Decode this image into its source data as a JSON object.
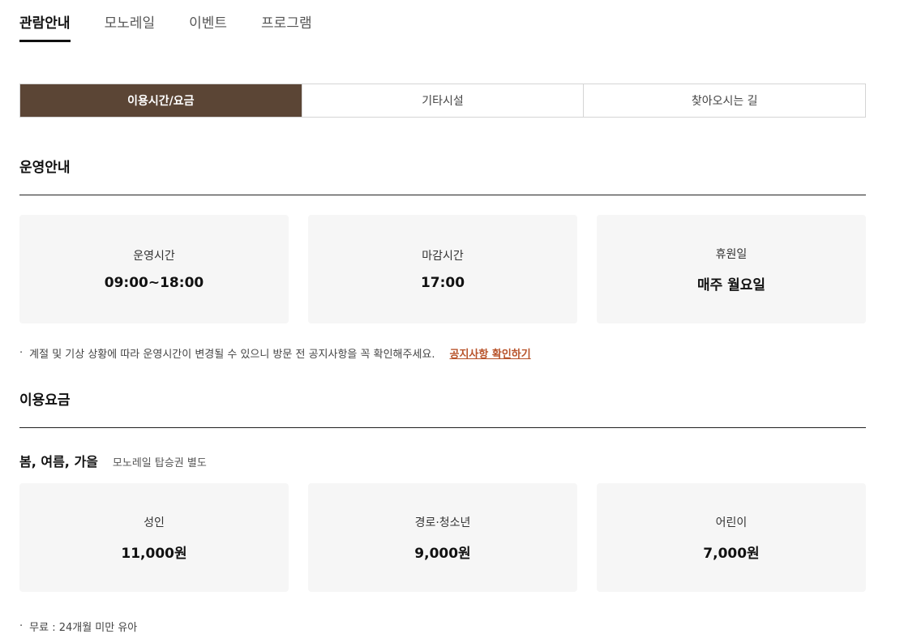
{
  "top_tabs": [
    "관람안내",
    "모노레일",
    "이벤트",
    "프로그램"
  ],
  "sub_tabs": [
    "이용시간/요금",
    "기타시설",
    "찾아오시는 길"
  ],
  "operation": {
    "title": "운영안내",
    "cards": [
      {
        "label": "운영시간",
        "value": "09:00~18:00"
      },
      {
        "label": "마감시간",
        "value": "17:00"
      },
      {
        "label": "휴원일",
        "value": "매주 월요일"
      }
    ],
    "note": "계절 및 기상 상황에 따라 운영시간이 변경될 수 있으니 방문 전 공지사항을 꼭 확인해주세요.",
    "note_link": "공지사항 확인하기"
  },
  "fees": {
    "title": "이용요금",
    "season_title": "봄, 여름, 가을",
    "season_sub": "모노레일 탑승권 별도",
    "cards": [
      {
        "label": "성인",
        "value": "11,000원"
      },
      {
        "label": "경로·청소년",
        "value": "9,000원"
      },
      {
        "label": "어린이",
        "value": "7,000원"
      }
    ],
    "note": "무료 : 24개월 미만 유아"
  }
}
